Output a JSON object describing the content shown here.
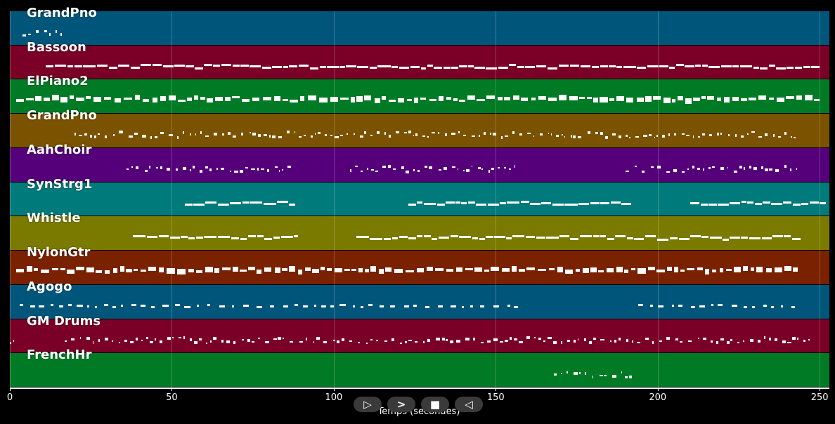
{
  "chart_data": {
    "type": "piano-roll",
    "xlabel": "Temps (secondes)",
    "xlim": [
      0,
      253
    ],
    "x_ticks": [
      0,
      50,
      100,
      150,
      200,
      250
    ],
    "grid": true,
    "tracks": [
      {
        "name": "GrandPno",
        "color": "#00567a",
        "segments": [
          [
            4,
            16,
            "sparse"
          ]
        ]
      },
      {
        "name": "Bassoon",
        "color": "#7a0028",
        "segments": [
          [
            11,
            250,
            "line"
          ]
        ]
      },
      {
        "name": "ElPiano2",
        "color": "#007a24",
        "segments": [
          [
            2,
            250,
            "dense"
          ]
        ]
      },
      {
        "name": "GrandPno",
        "color": "#7a5200",
        "segments": [
          [
            20,
            244,
            "sparse"
          ]
        ]
      },
      {
        "name": "AahChoir",
        "color": "#55007a",
        "segments": [
          [
            36,
            87,
            "sparse"
          ],
          [
            105,
            156,
            "sparse"
          ],
          [
            190,
            243,
            "sparse"
          ]
        ]
      },
      {
        "name": "SynStrg1",
        "color": "#007a7a",
        "segments": [
          [
            54,
            88,
            "line"
          ],
          [
            123,
            192,
            "line"
          ],
          [
            210,
            252,
            "line"
          ]
        ]
      },
      {
        "name": "Whistle",
        "color": "#7a7a00",
        "segments": [
          [
            38,
            89,
            "line"
          ],
          [
            107,
            244,
            "line"
          ]
        ]
      },
      {
        "name": "NylonGtr",
        "color": "#7a2200",
        "segments": [
          [
            2,
            244,
            "dense"
          ]
        ]
      },
      {
        "name": "Agogo",
        "color": "#00567a",
        "segments": [
          [
            3,
            157,
            "dashed"
          ],
          [
            194,
            244,
            "dashed"
          ]
        ]
      },
      {
        "name": "GM Drums",
        "color": "#7a0028",
        "segments": [
          [
            0,
            1,
            "sparse"
          ],
          [
            17,
            248,
            "sparse"
          ]
        ]
      },
      {
        "name": "FrenchHr",
        "color": "#007a24",
        "segments": [
          [
            168,
            192,
            "sparse"
          ]
        ]
      }
    ]
  },
  "controls": {
    "play_symbol": "▷",
    "next_symbol": ">",
    "stop_symbol": "■",
    "back_symbol": "◁"
  }
}
